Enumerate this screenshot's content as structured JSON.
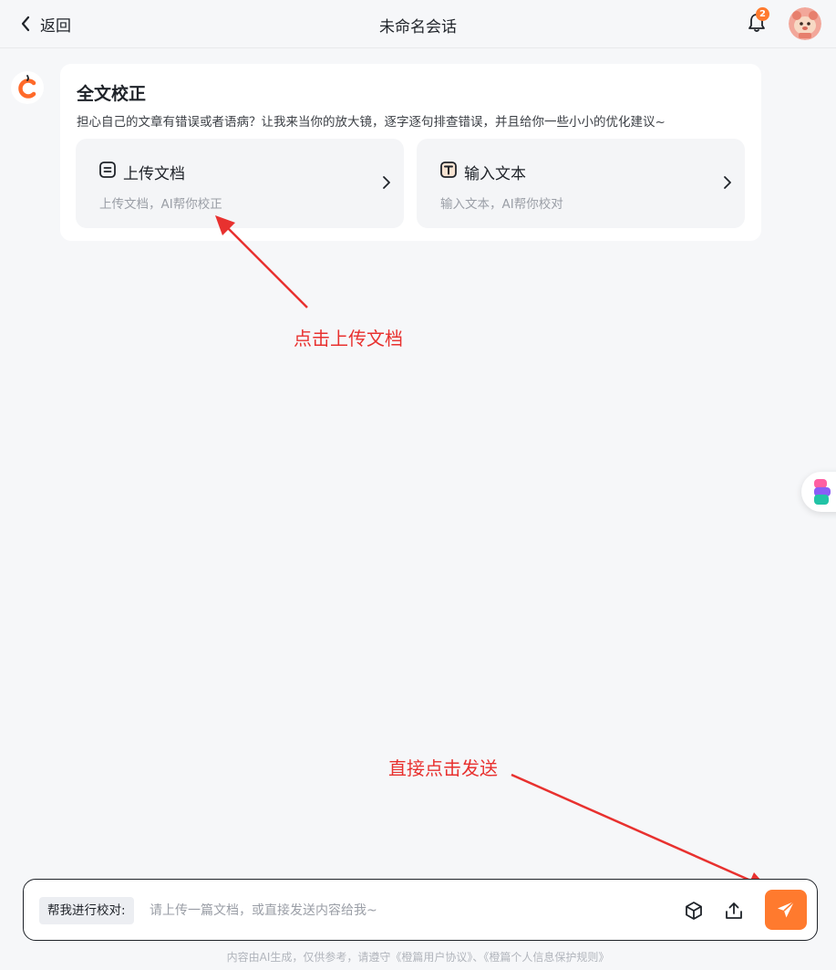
{
  "header": {
    "back_label": "返回",
    "title": "未命名会话",
    "notification_count": "2"
  },
  "card": {
    "title": "全文校正",
    "description": "担心自己的文章有错误或者语病？让我来当你的放大镜，逐字逐句排查错误，并且给你一些小小的优化建议~",
    "options": [
      {
        "title": "上传文档",
        "subtitle": "上传文档，AI帮你校正",
        "icon": "document-icon"
      },
      {
        "title": "输入文本",
        "subtitle": "输入文本，AI帮你校对",
        "icon": "text-icon"
      }
    ]
  },
  "annotations": {
    "upload_hint": "点击上传文档",
    "send_hint": "直接点击发送"
  },
  "composer": {
    "prefix": "帮我进行校对:",
    "placeholder": "请上传一篇文档，或直接发送内容给我~"
  },
  "footer": {
    "note": "内容由AI生成，仅供参考，请遵守《橙篇用户协议》、《橙篇个人信息保护规则》"
  },
  "colors": {
    "accent": "#ff7a2e",
    "annotation": "#e8312f",
    "background": "#f6f7f9"
  }
}
